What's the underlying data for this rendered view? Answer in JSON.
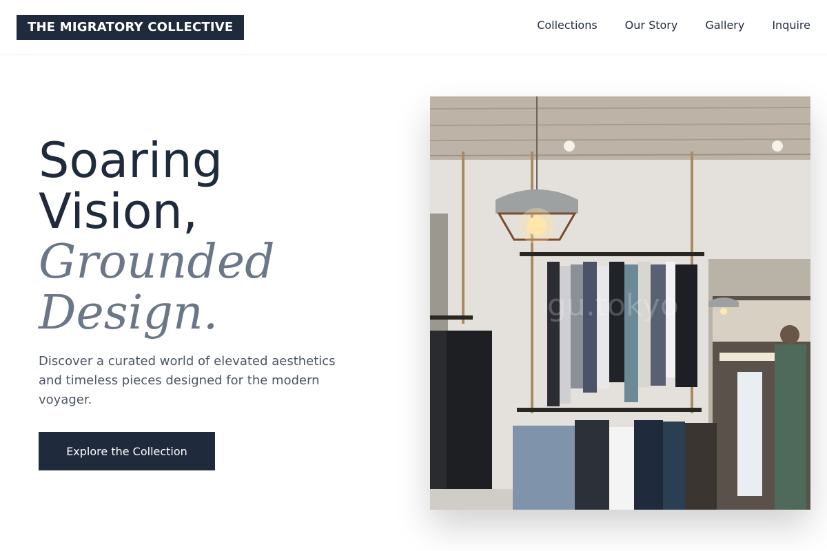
{
  "header": {
    "logo_text": "THE MIGRATORY COLLECTIVE",
    "nav": [
      {
        "label": "Collections"
      },
      {
        "label": "Our Story"
      },
      {
        "label": "Gallery"
      },
      {
        "label": "Inquire"
      }
    ]
  },
  "hero": {
    "title_line1": "Soaring",
    "title_line2": "Vision,",
    "title_line3": "Grounded",
    "title_line4": "Design.",
    "description": "Discover a curated world of elevated aesthetics and timeless pieces designed for the modern voyager.",
    "cta_label": "Explore the Collection",
    "image_watermark": "gu.tokyo"
  },
  "colors": {
    "primary": "#1f2a3c",
    "accent_text": "#6b7788",
    "body_text": "#4c5564",
    "background": "#ffffff"
  }
}
